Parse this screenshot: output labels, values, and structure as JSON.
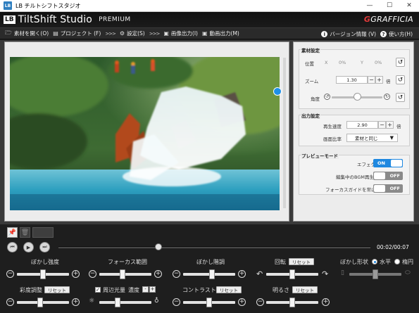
{
  "os_window": {
    "title": "LB チルトシフトスタジオ",
    "icon_text": "LB",
    "controls": [
      "—",
      "☐",
      "✕"
    ]
  },
  "app_header": {
    "brand_box": "LB",
    "title": "TiltShift Studio",
    "edition": "PREMIUM",
    "vendor": "GRAFFICIA",
    "vendor_mark": "G"
  },
  "menu": {
    "items": [
      {
        "label": "素材を開く(O)",
        "icon": "open-folder-icon"
      },
      {
        "label": "プロジェクト (F)",
        "icon": "project-icon"
      },
      {
        "label": "設定(S)",
        "icon": "gear-icon"
      },
      {
        "label": "画像出力(I)",
        "icon": "image-export-icon"
      },
      {
        "label": "動画出力(M)",
        "icon": "video-export-icon"
      }
    ],
    "separator": ">>>",
    "right_items": [
      {
        "label": "バージョン情報 (V)",
        "icon": "info-icon"
      },
      {
        "label": "使い方(H)",
        "icon": "help-icon"
      }
    ]
  },
  "settings": {
    "material": {
      "title": "素材設定",
      "position_label": "位置",
      "x_label": "X",
      "x_value": "0%",
      "y_label": "Y",
      "y_value": "0%",
      "zoom_label": "ズーム",
      "zoom_value": "1.30",
      "zoom_unit": "倍",
      "angle_label": "角度",
      "angle_level": 0.5
    },
    "output": {
      "title": "出力設定",
      "speed_label": "再生速度",
      "speed_value": "2.90",
      "speed_unit": "倍",
      "ratio_label": "画面比率",
      "ratio_value": "素材と同じ"
    },
    "preview": {
      "title": "プレビューモード",
      "effect_label": "エフェクト",
      "effect_state": "ON",
      "bgm_label": "編集中のBGM再生",
      "bgm_state": "OFF",
      "guide_label": "フォーカスガイドを常に表示",
      "guide_state": "OFF"
    }
  },
  "transport": {
    "timecode": "00:02/00:07",
    "position": 0.32
  },
  "controls": {
    "blur_strength": {
      "label": "ぼかし強度",
      "level": 0.5
    },
    "focus_range": {
      "label": "フォーカス範囲",
      "level": 0.45
    },
    "blur_tone": {
      "label": "ぼかし階調",
      "level": 0.55
    },
    "rotation": {
      "label": "回転",
      "reset": "リセット",
      "level": 0.5
    },
    "blur_shape": {
      "label": "ぼかし形状",
      "option_horizontal": "水平",
      "option_oval": "楕円",
      "selected": "水平",
      "level": 0.5
    },
    "saturation": {
      "label": "彩度調整",
      "reset": "リセット",
      "level": 0.45
    },
    "vignette": {
      "label": "周辺光量",
      "checked": true,
      "strength_label": "濃度",
      "minus": "-",
      "plus": "+",
      "level": 0.35
    },
    "contrast": {
      "label": "コントラスト",
      "reset": "リセット",
      "level": 0.5
    },
    "brightness": {
      "label": "明るさ",
      "reset": "リセット",
      "level": 0.5
    }
  },
  "colors": {
    "accent_blue": "#1f88e0",
    "app_bg": "#1e1e1e",
    "panel_bg": "#ececec",
    "brand_red": "#e03a3a"
  }
}
